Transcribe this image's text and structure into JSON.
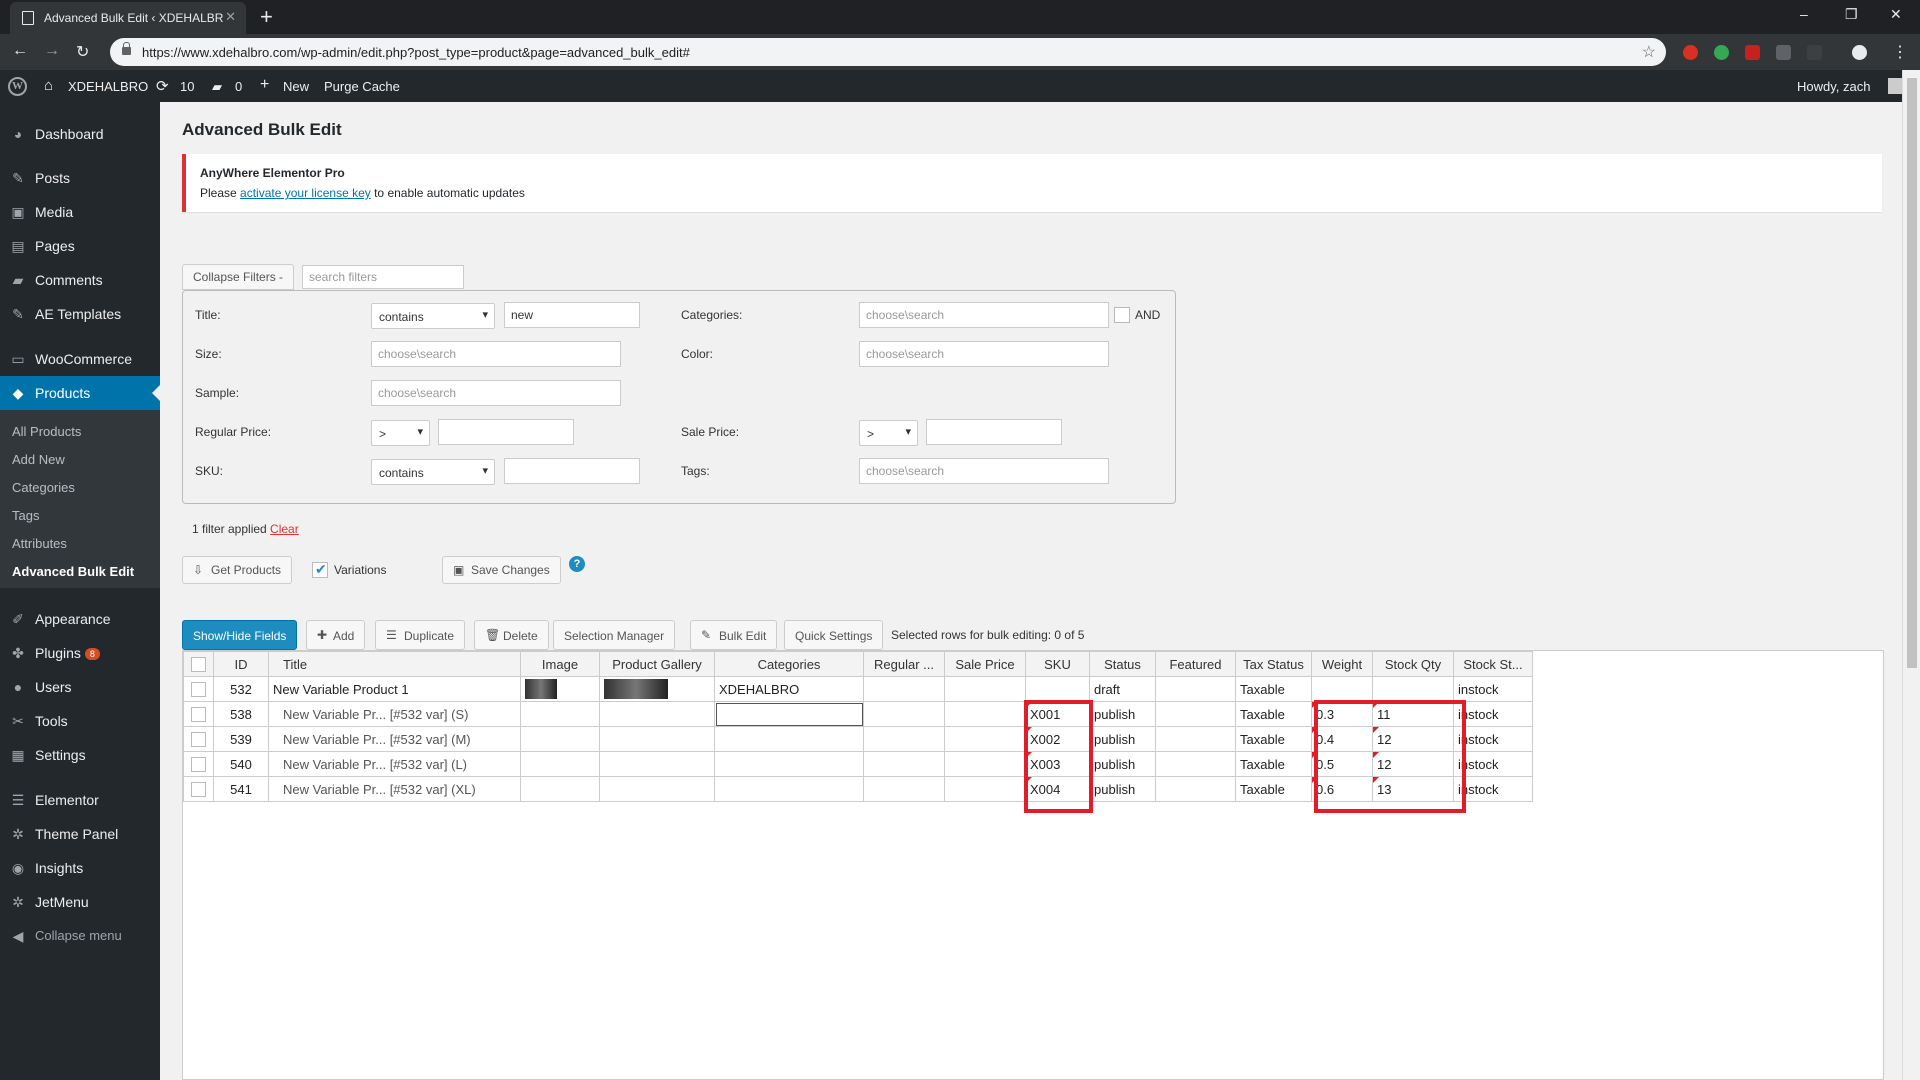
{
  "browser": {
    "tab_title": "Advanced Bulk Edit ‹ XDEHALBRO",
    "url": "https://www.xdehalbro.com/wp-admin/edit.php?post_type=product&page=advanced_bulk_edit#",
    "new_tab": "+",
    "minimize": "–",
    "restore": "❐",
    "close": "✕"
  },
  "adminbar": {
    "site_name": "XDEHALBRO",
    "updates": "10",
    "comments": "0",
    "new_label": "New",
    "purge_cache": "Purge Cache",
    "howdy": "Howdy, zach"
  },
  "sidebar": {
    "items": [
      {
        "label": "Dashboard",
        "icon": "dashboard-icon",
        "glyph": "◕"
      },
      {
        "label": "Posts",
        "icon": "pin-icon",
        "glyph": "✎"
      },
      {
        "label": "Media",
        "icon": "media-icon",
        "glyph": "▣"
      },
      {
        "label": "Pages",
        "icon": "pages-icon",
        "glyph": "▤"
      },
      {
        "label": "Comments",
        "icon": "comment-icon",
        "glyph": "▰"
      },
      {
        "label": "AE Templates",
        "icon": "pin-icon",
        "glyph": "✎"
      },
      {
        "label": "WooCommerce",
        "icon": "woo-icon",
        "glyph": "▭"
      },
      {
        "label": "Products",
        "icon": "box-icon",
        "glyph": "◆"
      },
      {
        "label": "Appearance",
        "icon": "brush-icon",
        "glyph": "✐"
      },
      {
        "label": "Plugins",
        "icon": "plug-icon",
        "glyph": "✤",
        "badge": "8"
      },
      {
        "label": "Users",
        "icon": "user-icon",
        "glyph": "●"
      },
      {
        "label": "Tools",
        "icon": "wrench-icon",
        "glyph": "✂"
      },
      {
        "label": "Settings",
        "icon": "settings-icon",
        "glyph": "▦"
      },
      {
        "label": "Elementor",
        "icon": "elementor-icon",
        "glyph": "☰"
      },
      {
        "label": "Theme Panel",
        "icon": "gear-icon",
        "glyph": "✲"
      },
      {
        "label": "Insights",
        "icon": "insights-icon",
        "glyph": "◉"
      },
      {
        "label": "JetMenu",
        "icon": "gear-icon",
        "glyph": "✲"
      },
      {
        "label": "Collapse menu",
        "icon": "collapse-icon",
        "glyph": "◀"
      }
    ],
    "submenu": [
      "All Products",
      "Add New",
      "Categories",
      "Tags",
      "Attributes",
      "Advanced Bulk Edit"
    ]
  },
  "page": {
    "title": "Advanced Bulk Edit",
    "notice_title": "AnyWhere Elementor Pro",
    "notice_pre": "Please ",
    "notice_link": "activate your license key",
    "notice_post": " to enable automatic updates"
  },
  "filters": {
    "collapse_label": "Collapse Filters -",
    "search_placeholder": "search filters",
    "title_label": "Title:",
    "title_op": "contains",
    "title_value": "new",
    "categories_label": "Categories:",
    "categories_placeholder": "choose\\search",
    "and_label": "AND",
    "size_label": "Size:",
    "size_placeholder": "choose\\search",
    "color_label": "Color:",
    "color_placeholder": "choose\\search",
    "sample_label": "Sample:",
    "sample_placeholder": "choose\\search",
    "regular_price_label": "Regular Price:",
    "regular_price_op": ">",
    "sale_price_label": "Sale Price:",
    "sale_price_op": ">",
    "sku_label": "SKU:",
    "sku_op": "contains",
    "tags_label": "Tags:",
    "tags_placeholder": "choose\\search",
    "applied_text": "1 filter applied ",
    "clear_label": "Clear"
  },
  "actions": {
    "get_products": "Get Products",
    "variations": "Variations",
    "save_changes": "Save Changes",
    "help": "?"
  },
  "toolbar": {
    "show_hide": "Show/Hide Fields",
    "add": "Add",
    "duplicate": "Duplicate",
    "delete": "Delete",
    "selection_manager": "Selection Manager",
    "bulk_edit": "Bulk Edit",
    "quick_settings": "Quick Settings",
    "selected_rows": "Selected rows for bulk editing:  0 of 5"
  },
  "table": {
    "columns": [
      "ID",
      "Title",
      "Image",
      "Product Gallery",
      "Categories",
      "Regular ...",
      "Sale Price",
      "SKU",
      "Status",
      "Featured",
      "Tax Status",
      "Weight",
      "Stock Qty",
      "Stock St..."
    ],
    "rows": [
      {
        "id": "532",
        "title": "New Variable Product 1",
        "image": true,
        "gallery": true,
        "categories": "XDEHALBRO",
        "regular": "",
        "sale": "",
        "sku": "",
        "status": "draft",
        "featured": "",
        "tax": "Taxable",
        "weight": "",
        "stock_qty": "",
        "stock_status": "instock",
        "variation": false
      },
      {
        "id": "538",
        "title": "New Variable Pr... [#532 var] (S)",
        "image": false,
        "gallery": false,
        "categories": "",
        "regular": "",
        "sale": "",
        "sku": "X001",
        "status": "publish",
        "featured": "",
        "tax": "Taxable",
        "weight": "0.3",
        "stock_qty": "11",
        "stock_status": "instock",
        "variation": true
      },
      {
        "id": "539",
        "title": "New Variable Pr... [#532 var] (M)",
        "image": false,
        "gallery": false,
        "categories": "",
        "regular": "",
        "sale": "",
        "sku": "X002",
        "status": "publish",
        "featured": "",
        "tax": "Taxable",
        "weight": "0.4",
        "stock_qty": "12",
        "stock_status": "instock",
        "variation": true
      },
      {
        "id": "540",
        "title": "New Variable Pr... [#532 var] (L)",
        "image": false,
        "gallery": false,
        "categories": "",
        "regular": "",
        "sale": "",
        "sku": "X003",
        "status": "publish",
        "featured": "",
        "tax": "Taxable",
        "weight": "0.5",
        "stock_qty": "12",
        "stock_status": "instock",
        "variation": true
      },
      {
        "id": "541",
        "title": "New Variable Pr... [#532 var] (XL)",
        "image": false,
        "gallery": false,
        "categories": "",
        "regular": "",
        "sale": "",
        "sku": "X004",
        "status": "publish",
        "featured": "",
        "tax": "Taxable",
        "weight": "0.6",
        "stock_qty": "13",
        "stock_status": "instock",
        "variation": true
      }
    ]
  },
  "colors": {
    "accent": "#0073aa",
    "highlight": "#e11d2a",
    "admin_bg": "#23282d"
  }
}
